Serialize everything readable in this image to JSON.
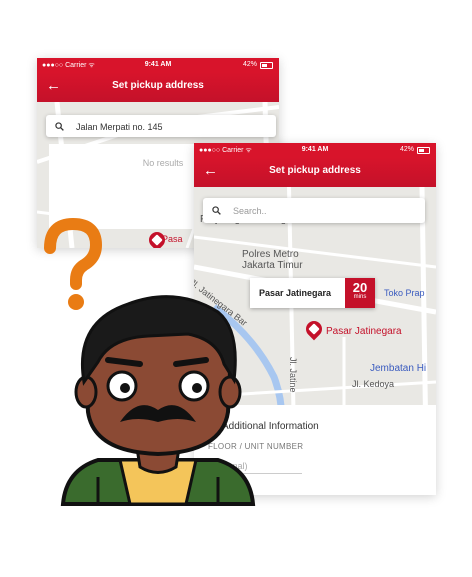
{
  "back_screen": {
    "status": {
      "carrier": "●●●○○ Carrier ᯤ",
      "time": "9:41 AM",
      "battery": "42%"
    },
    "nav_title": "Set pickup address",
    "search_value": "Jalan Merpati no. 145",
    "no_results": "No results",
    "map_labels": {
      "pasar_fragment": "Pasa"
    }
  },
  "front_screen": {
    "status": {
      "carrier": "●●●○○ Carrier ᯤ",
      "time": "9:41 AM",
      "battery": "42%"
    },
    "nav_title": "Set pickup address",
    "search_placeholder": "Search..",
    "map_labels": {
      "perjuangan": "Perjuangan Jatinegara",
      "polres": "Polres Metro\nJakarta Timur",
      "pasar": "Pasar Jatinegara",
      "toko": "Toko Prap",
      "jembatan": "Jembatan Hi",
      "kedoya": "Jl. Kedoya",
      "jatinegara_barat": "Jl. Jatinegara Bar",
      "jatine": "Jl. Jatine"
    },
    "eta": {
      "place": "Pasar Jatinegara",
      "minutes": "20",
      "unit": "mins"
    },
    "additional_info": {
      "title": "Additional Information",
      "floor_label": "FLOOR / UNIT NUMBER",
      "floor_placeholder": "(Optional)"
    }
  },
  "colors": {
    "brand_red": "#d8142b",
    "question_orange": "#e97c14",
    "jacket_green": "#3a6b2d",
    "shirt_yellow": "#f4c55a",
    "skin": "#8b4a34"
  },
  "icons": [
    "back-arrow-icon",
    "search-icon",
    "battery-icon",
    "map-pin-icon",
    "question-mark-icon"
  ]
}
